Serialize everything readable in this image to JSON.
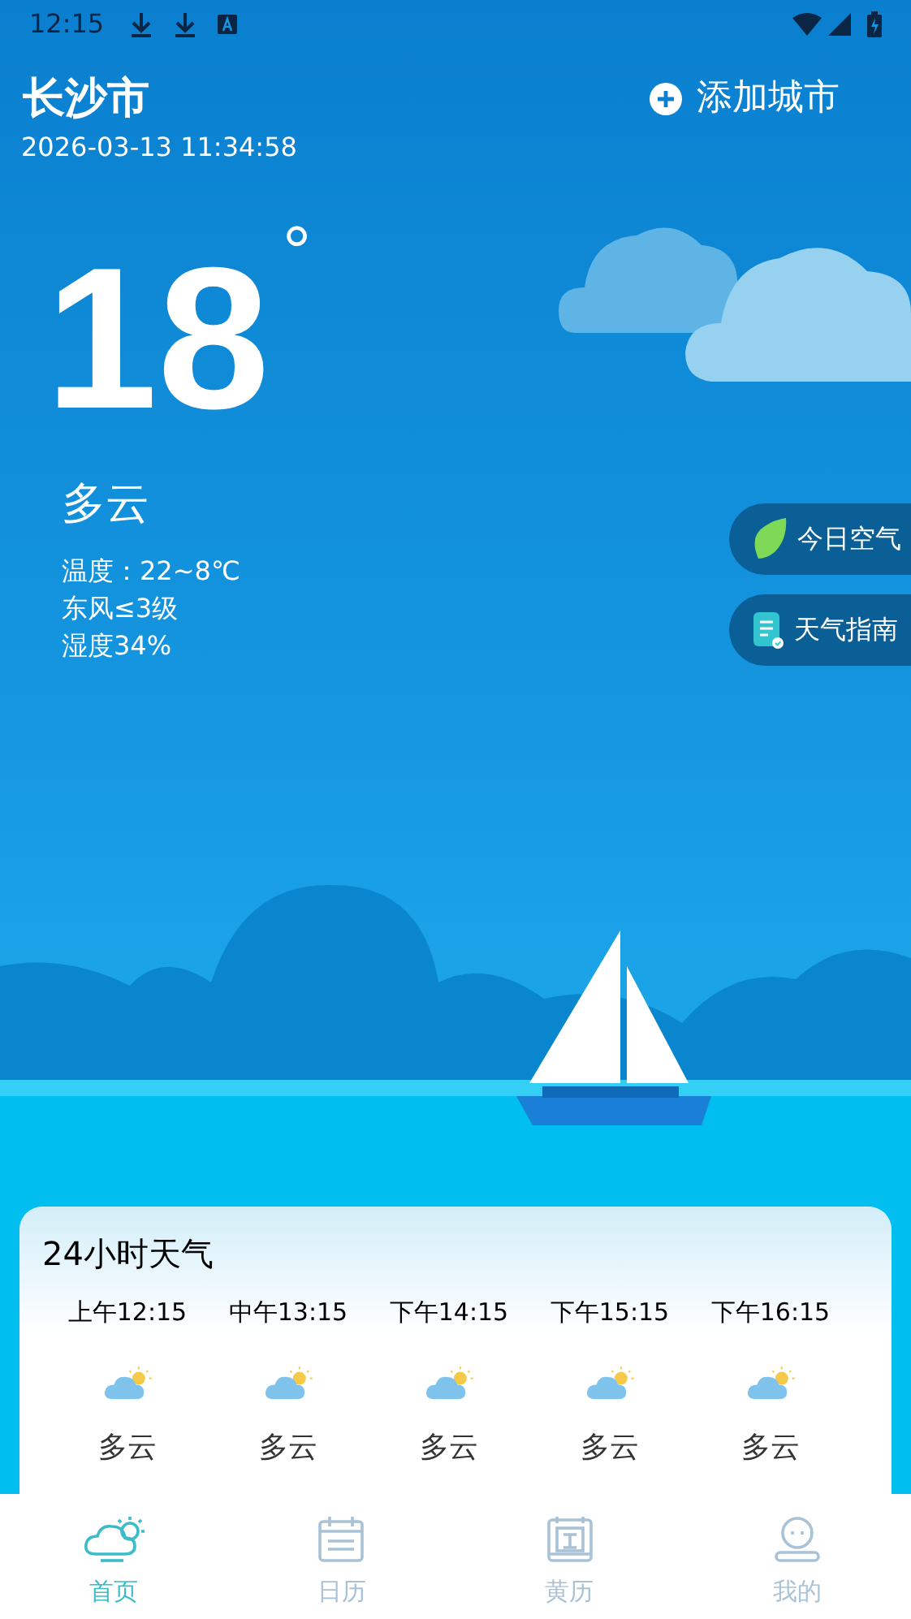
{
  "status_bar": {
    "time": "12:15"
  },
  "header": {
    "city": "长沙市",
    "datetime": "2026-03-13 11:34:58",
    "add_button": "添加城市"
  },
  "current": {
    "temperature": "18",
    "degree_mark": "°",
    "condition": "多云",
    "details": [
      "温度：22~8℃",
      "东风≤3级",
      "湿度34%"
    ]
  },
  "side_buttons": [
    {
      "kind": "leaf",
      "label": "今日空气"
    },
    {
      "kind": "note",
      "label": "天气指南"
    }
  ],
  "hourly": {
    "title": "24小时天气",
    "items": [
      {
        "time": "上午12:15",
        "condition": "多云"
      },
      {
        "time": "中午13:15",
        "condition": "多云"
      },
      {
        "time": "下午14:15",
        "condition": "多云"
      },
      {
        "time": "下午15:15",
        "condition": "多云"
      },
      {
        "time": "下午16:15",
        "condition": "多云"
      }
    ]
  },
  "nav": [
    {
      "kind": "home",
      "label": "首页",
      "selected": true
    },
    {
      "kind": "calendar",
      "label": "日历",
      "selected": false
    },
    {
      "kind": "almanac",
      "label": "黄历",
      "selected": false
    },
    {
      "kind": "profile",
      "label": "我的",
      "selected": false
    }
  ]
}
